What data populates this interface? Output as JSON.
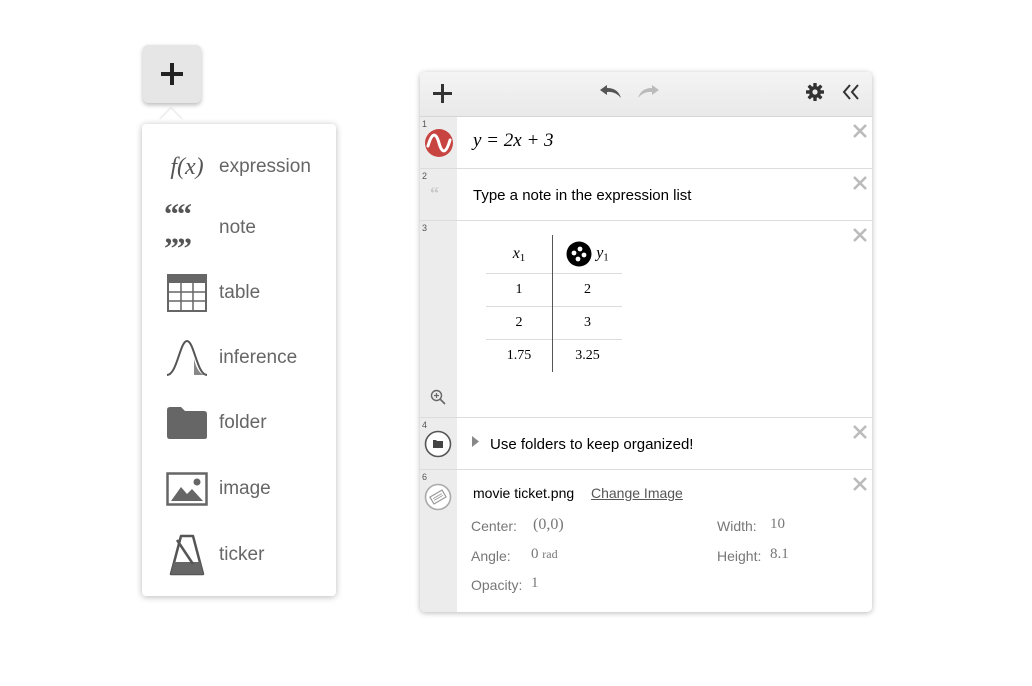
{
  "add_menu": {
    "button_icon": "plus-icon",
    "items": [
      {
        "label": "expression",
        "icon": "fx-icon",
        "glyph": "f(x)"
      },
      {
        "label": "note",
        "icon": "quote-icon",
        "glyph": "““ ””"
      },
      {
        "label": "table",
        "icon": "table-icon"
      },
      {
        "label": "inference",
        "icon": "bell-curve-icon"
      },
      {
        "label": "folder",
        "icon": "folder-icon"
      },
      {
        "label": "image",
        "icon": "image-icon"
      },
      {
        "label": "ticker",
        "icon": "metronome-icon"
      }
    ]
  },
  "toolbar": {
    "add_icon": "plus-icon",
    "undo_icon": "undo-icon",
    "redo_icon": "redo-icon",
    "settings_icon": "gear-icon",
    "collapse_icon": "double-chevron-left-icon"
  },
  "rows": {
    "expression": {
      "num": "1",
      "latex": "y = 2x + 3",
      "color": "#c74440"
    },
    "note": {
      "num": "2",
      "text": "Type a note in the expression list"
    },
    "table": {
      "num": "3",
      "headers": [
        {
          "name": "x",
          "sub": "1"
        },
        {
          "name": "y",
          "sub": "1"
        }
      ],
      "cells": [
        [
          "1",
          "2"
        ],
        [
          "2",
          "3"
        ],
        [
          "1.75",
          "3.25"
        ]
      ]
    },
    "folder": {
      "num": "4",
      "text": "Use folders to keep organized!"
    },
    "image": {
      "num": "6",
      "filename": "movie ticket.png",
      "change_link": "Change Image",
      "center_label": "Center:",
      "center_value": "(0,0)",
      "width_label": "Width:",
      "width_value": "10",
      "angle_label": "Angle:",
      "angle_value": "0",
      "angle_unit": "rad",
      "height_label": "Height:",
      "height_value": "8.1",
      "opacity_label": "Opacity:",
      "opacity_value": "1"
    }
  }
}
